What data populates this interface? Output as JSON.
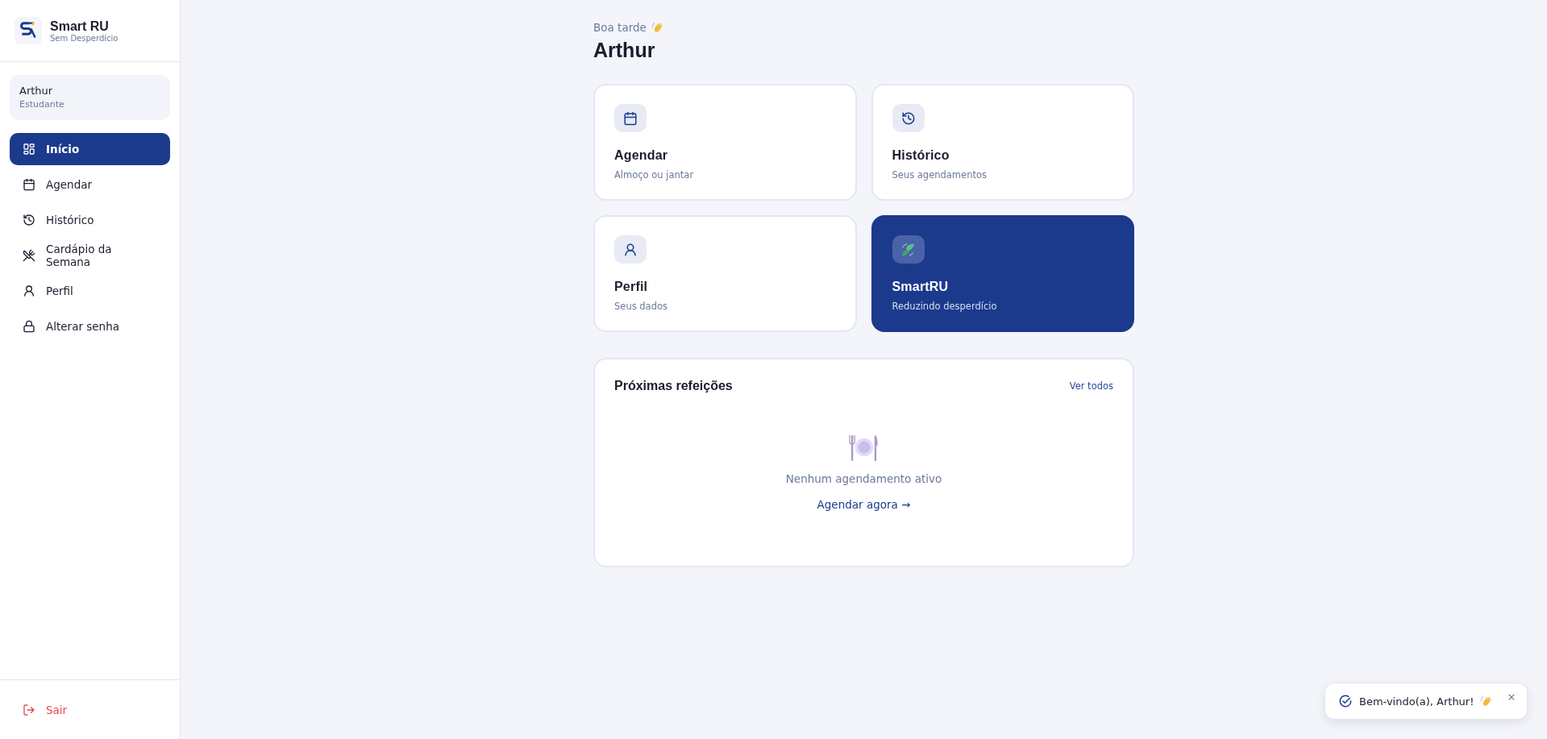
{
  "brand": {
    "name": "Smart RU",
    "tagline": "Sem Desperdício"
  },
  "user": {
    "name": "Arthur",
    "role": "Estudante"
  },
  "nav": [
    {
      "label": "Início",
      "selected": true
    },
    {
      "label": "Agendar",
      "selected": false
    },
    {
      "label": "Histórico",
      "selected": false
    },
    {
      "label": "Cardápio da Semana",
      "selected": false
    },
    {
      "label": "Perfil",
      "selected": false
    },
    {
      "label": "Alterar senha",
      "selected": false
    }
  ],
  "logout": {
    "label": "Sair"
  },
  "greeting": {
    "salutation": "Boa tarde",
    "name": "Arthur"
  },
  "cards": [
    {
      "kind": "light",
      "title": "Agendar",
      "subtitle": "Almoço ou jantar"
    },
    {
      "kind": "light",
      "title": "Histórico",
      "subtitle": "Seus agendamentos"
    },
    {
      "kind": "light",
      "title": "Perfil",
      "subtitle": "Seus dados"
    },
    {
      "kind": "highlight",
      "title": "SmartRU",
      "subtitle": "Reduzindo desperdício"
    }
  ],
  "upcoming": {
    "title": "Próximas refeições",
    "link": "Ver todos",
    "empty_message": "Nenhum agendamento ativo",
    "action": "Agendar agora →"
  },
  "toast": {
    "message": "Bem-vindo(a), Arthur!"
  }
}
